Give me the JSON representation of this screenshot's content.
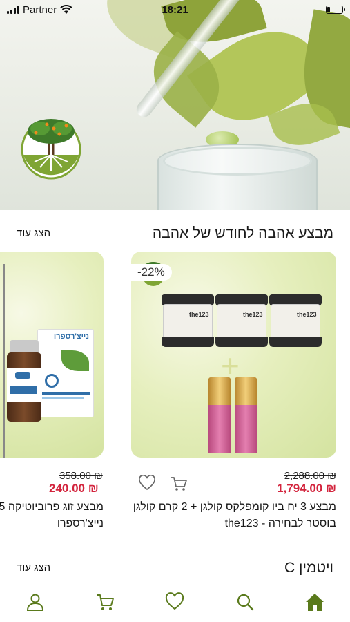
{
  "status_bar": {
    "carrier": "Partner",
    "time": "18:21"
  },
  "hero": {
    "logo_icon": "tree-of-life-logo",
    "image": "serum-pipette-leaves"
  },
  "section1": {
    "title": "מבצע אהבה לחודש של אהבה",
    "show_more": "הצג עוד",
    "products": [
      {
        "discount_badge": "-22%",
        "price_old": "2,288.00 ₪",
        "price_new": "1,794.00 ₪",
        "title_line1": "מבצע 3 יח ביו קומפלקס קולגן + 2 קרם קולגן",
        "title_line2": "בוסטר לבחירה  - the123",
        "jar_label": "the123"
      },
      {
        "price_old": "358.00 ₪",
        "price_new": "240.00 ₪",
        "title_line1": "מבצע זוג פרוביוטיקה 5",
        "title_line2": "נייצ'רספרו",
        "box_brand": "נייצ'רספרו"
      }
    ]
  },
  "section2": {
    "title": "ויטמין C",
    "show_more": "הצג עוד"
  },
  "bottom_nav": [
    "home-icon",
    "search-icon",
    "heart-icon",
    "cart-icon",
    "user-icon"
  ],
  "colors": {
    "accent_green": "#5a7a1c",
    "sale_red": "#d3243d",
    "card_green": "#dfe9b4"
  }
}
